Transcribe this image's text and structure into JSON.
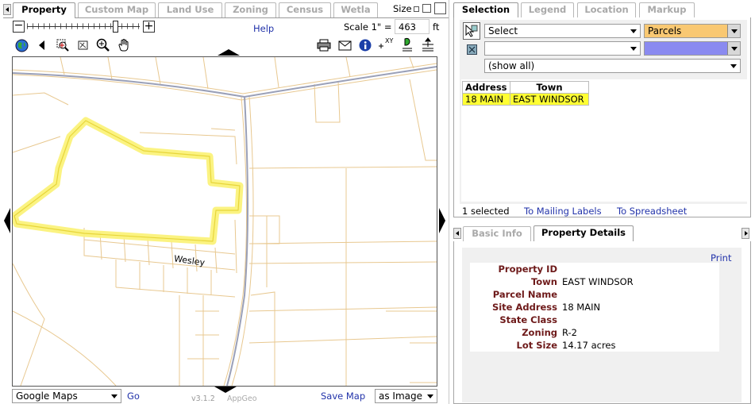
{
  "left_tabs": [
    "Property",
    "Custom Map",
    "Land Use",
    "Zoning",
    "Census",
    "Wetla"
  ],
  "size_label": "Size",
  "help_link": "Help",
  "scale": {
    "label": "Scale 1\" =",
    "value": "463",
    "unit": "ft"
  },
  "map": {
    "road_label": "Wesley"
  },
  "bottom_bar": {
    "basemap": "Google Maps",
    "go_label": "Go",
    "version": "v3.1.2",
    "vendor": "AppGeo",
    "save_map": "Save Map",
    "save_format": "as Image"
  },
  "right_tabs": [
    "Selection",
    "Legend",
    "Location",
    "Markup"
  ],
  "selection": {
    "action": "Select",
    "layer": "Parcels",
    "second_action": "",
    "filter": "(show all)",
    "table": {
      "headers": [
        "Address",
        "Town"
      ],
      "rows": [
        {
          "address": "18 MAIN",
          "town": "EAST WINDSOR"
        }
      ]
    },
    "count_text": "1 selected",
    "mailing_labels": "To Mailing Labels",
    "spreadsheet": "To Spreadsheet"
  },
  "detail_tabs": [
    "Basic Info",
    "Property Details"
  ],
  "details": {
    "print_label": "Print",
    "fields": [
      {
        "label": "Property ID",
        "value": ""
      },
      {
        "label": "Town",
        "value": "EAST WINDSOR"
      },
      {
        "label": "Parcel Name",
        "value": ""
      },
      {
        "label": "Site Address",
        "value": "18 MAIN"
      },
      {
        "label": "State Class",
        "value": ""
      },
      {
        "label": "Zoning",
        "value": "R-2"
      },
      {
        "label": "Lot Size",
        "value": "14.17 acres"
      }
    ]
  },
  "colors": {
    "highlight": "#fbf27a",
    "parcel_line": "#e8c890",
    "layer_fill": "#f9c872",
    "color_swatch": "#8a8af0",
    "selected_row": "#ffff33",
    "link": "#2233aa",
    "label_dark_red": "#6e1a1a"
  },
  "icons": [
    "globe-icon",
    "back-arrow-icon",
    "zoom-extent-icon",
    "zoom-box-icon",
    "zoom-in-icon",
    "pan-hand-icon",
    "print-icon",
    "email-icon",
    "info-icon",
    "xy-icon",
    "identify-icon",
    "pan-arrows-icon",
    "select-tool-icon",
    "select-area-icon"
  ]
}
